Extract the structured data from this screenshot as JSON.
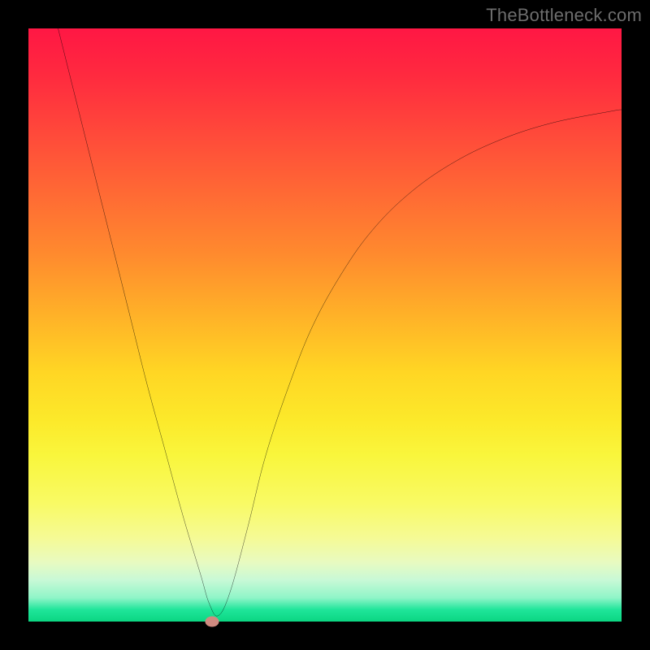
{
  "attribution": "TheBottleneck.com",
  "chart_data": {
    "type": "line",
    "title": "",
    "xlabel": "",
    "ylabel": "",
    "xlim": [
      0,
      100
    ],
    "ylim": [
      0,
      100
    ],
    "x": [
      5,
      8,
      11,
      14,
      17,
      20,
      23,
      26,
      29,
      30.5,
      32,
      34,
      37,
      40,
      44,
      48,
      53,
      58,
      64,
      71,
      79,
      88,
      98,
      100
    ],
    "values": [
      100,
      88,
      76,
      64,
      52,
      40,
      29,
      18,
      8,
      3,
      1,
      5,
      16,
      28,
      40,
      50,
      59,
      66,
      72,
      77,
      81,
      84,
      86,
      86.3
    ],
    "marker": {
      "x": 31,
      "y": 0
    },
    "gradient_stops": [
      {
        "pos": 0,
        "color": "#ff1744",
        "meaning": "high bottleneck"
      },
      {
        "pos": 50,
        "color": "#ffd624",
        "meaning": "moderate"
      },
      {
        "pos": 100,
        "color": "#0bd682",
        "meaning": "no bottleneck"
      }
    ]
  }
}
